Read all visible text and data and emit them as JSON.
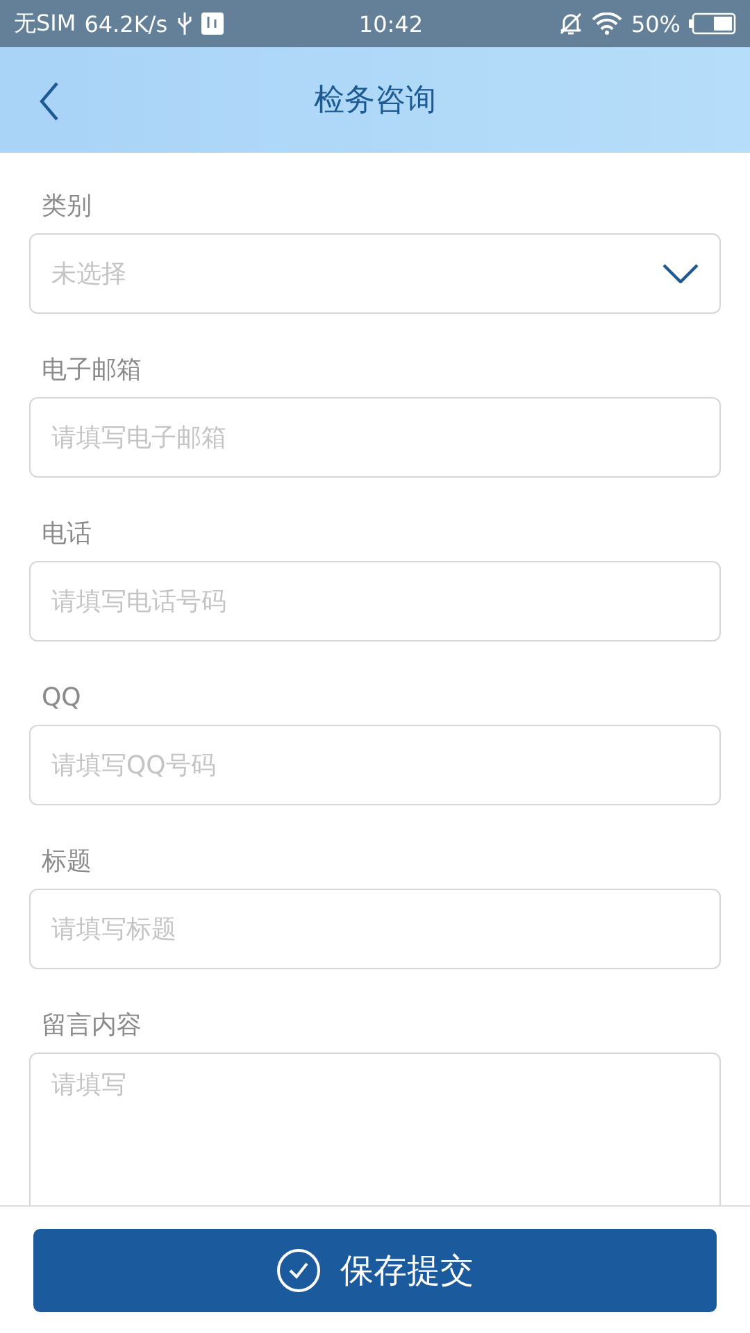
{
  "status_bar": {
    "carrier": "无SIM",
    "speed": "64.2K/s",
    "time": "10:42",
    "battery": "50%"
  },
  "header": {
    "title": "检务咨询"
  },
  "fields": [
    {
      "kind": "select",
      "label": "类别",
      "placeholder": "未选择"
    },
    {
      "kind": "text",
      "label": "电子邮箱",
      "placeholder": "请填写电子邮箱"
    },
    {
      "kind": "text",
      "label": "电话",
      "placeholder": "请填写电话号码"
    },
    {
      "kind": "text",
      "label": "QQ",
      "placeholder": "请填写QQ号码"
    },
    {
      "kind": "text",
      "label": "标题",
      "placeholder": "请填写标题"
    },
    {
      "kind": "textarea",
      "label": "留言内容",
      "placeholder": "请填写"
    }
  ],
  "submit": {
    "label": "保存提交"
  }
}
